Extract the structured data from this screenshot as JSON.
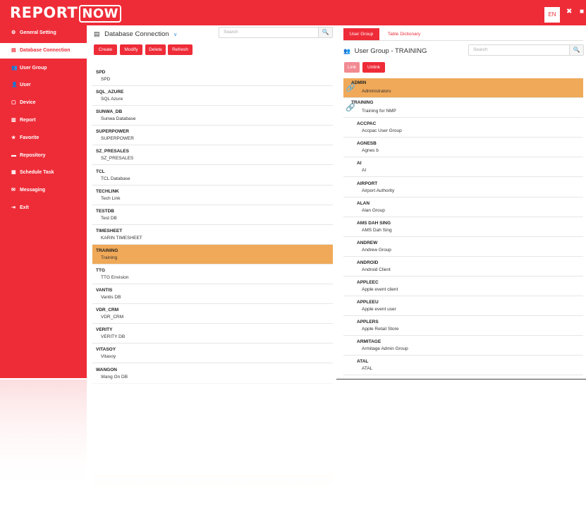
{
  "app": {
    "logo_report": "REPORT",
    "logo_now": "NOW",
    "lang": "EN",
    "accent_color": "#ee2c38",
    "selected_color": "#f0a958"
  },
  "sidebar": {
    "items": [
      {
        "icon": "gear-icon",
        "glyph": "⚙",
        "label": "General Setting"
      },
      {
        "icon": "database-icon",
        "glyph": "▤",
        "label": "Database Connection",
        "active": true
      },
      {
        "icon": "users-icon",
        "glyph": "👥",
        "label": "User Group"
      },
      {
        "icon": "user-icon",
        "glyph": "👤",
        "label": "User"
      },
      {
        "icon": "device-icon",
        "glyph": "▢",
        "label": "Device"
      },
      {
        "icon": "bar-chart-icon",
        "glyph": "▥",
        "label": "Report"
      },
      {
        "icon": "star-icon",
        "glyph": "★",
        "label": "Favorite"
      },
      {
        "icon": "folder-icon",
        "glyph": "▬",
        "label": "Repository"
      },
      {
        "icon": "calendar-icon",
        "glyph": "▦",
        "label": "Schedule Task"
      },
      {
        "icon": "envelope-icon",
        "glyph": "✉",
        "label": "Messaging"
      },
      {
        "icon": "exit-icon",
        "glyph": "⇥",
        "label": "Exit"
      }
    ]
  },
  "db_pane": {
    "title": "Database Connection",
    "search_placeholder": "Search",
    "buttons": {
      "create": "Create",
      "modify": "Modify",
      "delete": "Delete",
      "refresh": "Refresh"
    },
    "rows": [
      {
        "code": "SPD",
        "desc": "SPD"
      },
      {
        "code": "SQL_AZURE",
        "desc": "SQL Azure"
      },
      {
        "code": "SUNWA_DB",
        "desc": "Sunwa Database"
      },
      {
        "code": "SUPERPOWER",
        "desc": "SUPERPOWER"
      },
      {
        "code": "SZ_PRESALES",
        "desc": "SZ_PRESALES"
      },
      {
        "code": "TCL",
        "desc": "TCL Database"
      },
      {
        "code": "TECHLINK",
        "desc": "Tech Link"
      },
      {
        "code": "TESTDB",
        "desc": "Test DB"
      },
      {
        "code": "TIMESHEET",
        "desc": "KARIN TIMESHEET"
      },
      {
        "code": "TRAINING",
        "desc": "Training",
        "selected": true
      },
      {
        "code": "TTG",
        "desc": "TTG Envision"
      },
      {
        "code": "VANTIS",
        "desc": "Vantis DB"
      },
      {
        "code": "VDR_CRM",
        "desc": "VDR_CRM"
      },
      {
        "code": "VERITY",
        "desc": "VERITY DB"
      },
      {
        "code": "VITASOY",
        "desc": "Vitasoy"
      },
      {
        "code": "WANGON",
        "desc": "Wang On DB"
      }
    ]
  },
  "group_pane": {
    "tabs": {
      "user_group": "User Group",
      "table_dictionary": "Table Dictionary"
    },
    "title": "User Group - TRAINING",
    "search_placeholder": "Search",
    "buttons": {
      "link": "Link",
      "unlink": "Unlink"
    },
    "rows": [
      {
        "code": "ADMIN",
        "desc": "Administrators",
        "linked": true,
        "selected": true
      },
      {
        "code": "TRAINING",
        "desc": "Training for NMP",
        "linked": true
      },
      {
        "code": "ACCPAC",
        "desc": "Accpac User Group"
      },
      {
        "code": "AGNESB",
        "desc": "Agnes b"
      },
      {
        "code": "AI",
        "desc": "AI"
      },
      {
        "code": "AIRPORT",
        "desc": "Airport Authority"
      },
      {
        "code": "ALAN",
        "desc": "Alan Group"
      },
      {
        "code": "AMS DAH SING",
        "desc": "AMS Dah Sing"
      },
      {
        "code": "ANDREW",
        "desc": "Andrew Group"
      },
      {
        "code": "ANDROID",
        "desc": "Android Client"
      },
      {
        "code": "APPLEEC",
        "desc": "Apple event client"
      },
      {
        "code": "APPLEEU",
        "desc": "Apple event user"
      },
      {
        "code": "APPLERS",
        "desc": "Apple Retail Store"
      },
      {
        "code": "ARMITAGE",
        "desc": "Armitage Admin Group"
      },
      {
        "code": "ATAL",
        "desc": "ATAL"
      }
    ]
  }
}
